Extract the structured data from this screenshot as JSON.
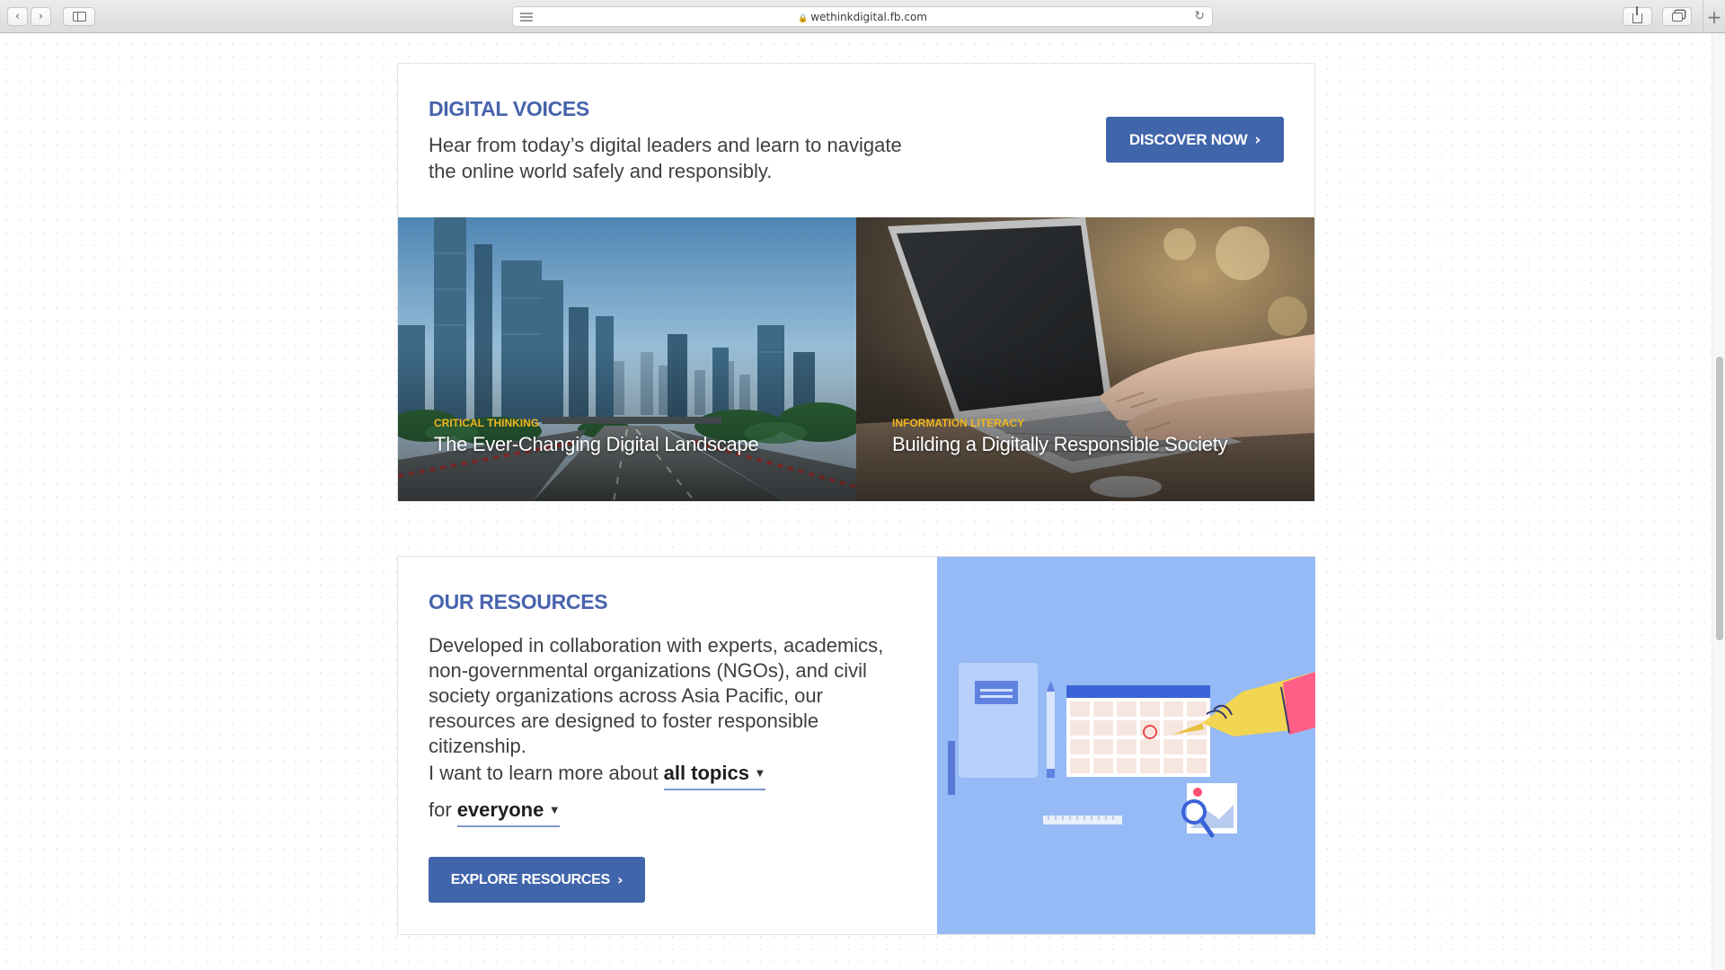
{
  "browser": {
    "url": "wethinkdigital.fb.com",
    "lock_icon": "🔒"
  },
  "digital_voices": {
    "title": "DIGITAL VOICES",
    "description": "Hear from today’s digital leaders and learn to navigate the online world safely and responsibly.",
    "button_label": "DISCOVER NOW",
    "tiles": [
      {
        "category": "CRITICAL THINKING",
        "title": "The Ever-Changing Digital Landscape",
        "image": "city-skyline-photo"
      },
      {
        "category": "INFORMATION LITERACY",
        "title": "Building a Digitally Responsible Society",
        "image": "laptop-typing-photo"
      }
    ]
  },
  "resources": {
    "title": "OUR RESOURCES",
    "description": "Developed in collaboration with experts, academics, non-governmental organizations (NGOs), and civil society organizations across Asia Pacific, our resources are designed to foster responsible citizenship.",
    "filter_prefix": "I want to learn more about",
    "topic_selected": "all topics",
    "audience_prefix": "for",
    "audience_selected": "everyone",
    "button_label": "EXPLORE RESOURCES",
    "illustration": "calendar-planning-illustration"
  },
  "colors": {
    "brand_blue": "#4165ab",
    "title_blue": "#4763ac",
    "accent_yellow": "#f1b51c",
    "illustration_bg": "#95baf5"
  }
}
